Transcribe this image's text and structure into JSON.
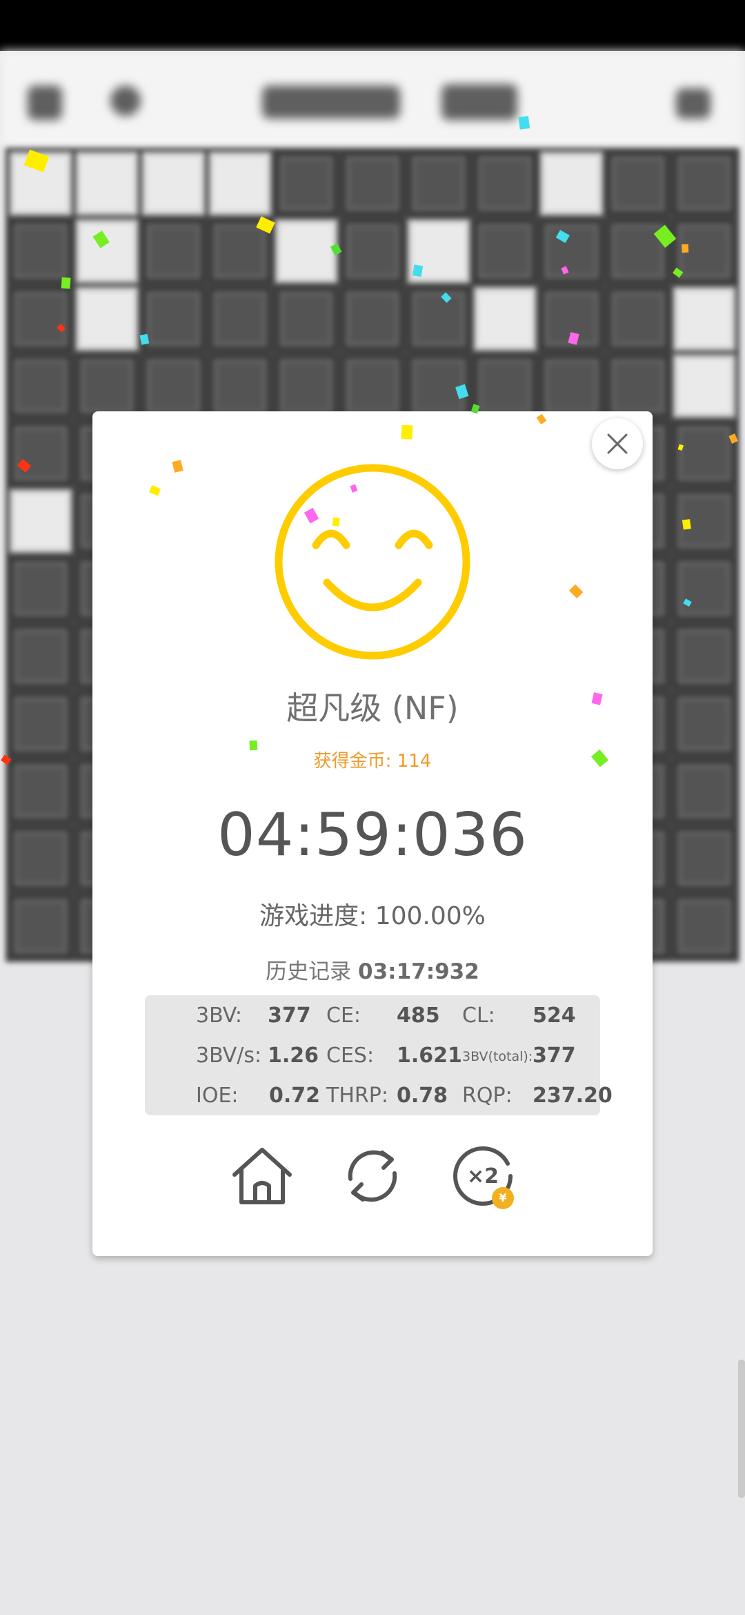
{
  "result": {
    "rank_title": "超凡级 (NF)",
    "coins_label": "获得金币: 114",
    "time": "04:59:036",
    "progress_label": "游戏进度:",
    "progress_value": "100.00%",
    "record_label": "历史记录",
    "record_value": "03:17:932"
  },
  "stats": [
    {
      "label": "3BV:",
      "value": "377"
    },
    {
      "label": "CE:",
      "value": "485"
    },
    {
      "label": "CL:",
      "value": "524"
    },
    {
      "label": "3BV/s:",
      "value": "1.26"
    },
    {
      "label": "CES:",
      "value": "1.621"
    },
    {
      "label": "3BV(total):",
      "value": "377"
    },
    {
      "label": "IOE:",
      "value": "0.72"
    },
    {
      "label": "THRP:",
      "value": "0.78"
    },
    {
      "label": "RQP:",
      "value": "237.20"
    }
  ],
  "actions": {
    "home_icon": "home-icon",
    "replay_icon": "refresh-icon",
    "double_icon": "x2-coin-icon",
    "double_label": "×2",
    "coin_symbol": "¥"
  },
  "colors": {
    "smiley": "#ffcc00",
    "coins_text": "#ef9a2a",
    "panel_bg": "#e6e6e6"
  }
}
